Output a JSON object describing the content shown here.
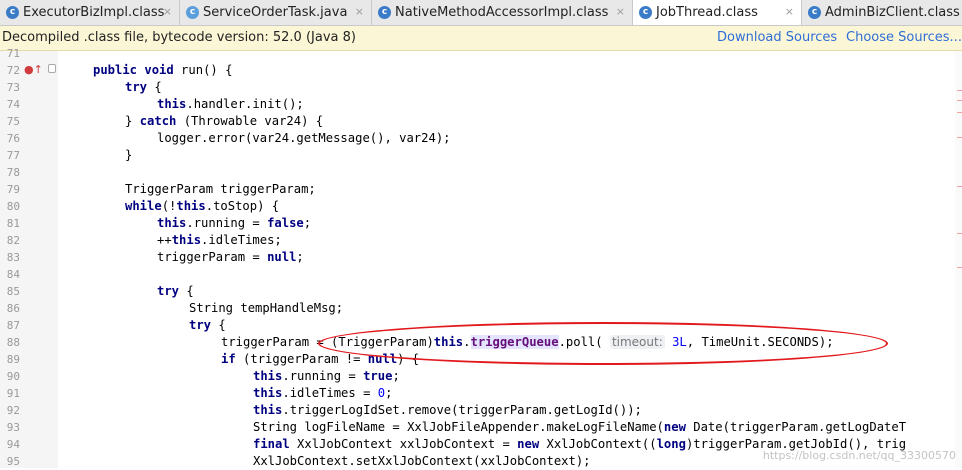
{
  "tabs": [
    {
      "label": "ExecutorBizImpl.class",
      "icon": "class-file-icon",
      "active": false
    },
    {
      "label": "ServiceOrderTask.java",
      "icon": "java-file-icon",
      "active": false
    },
    {
      "label": "NativeMethodAccessorImpl.class",
      "icon": "class-file-icon",
      "active": false
    },
    {
      "label": "JobThread.class",
      "icon": "class-file-icon",
      "active": true
    },
    {
      "label": "AdminBizClient.class",
      "icon": "class-file-icon",
      "active": false
    }
  ],
  "close_glyph": "×",
  "banner": {
    "message": "Decompiled .class file, bytecode version: 52.0 (Java 8)",
    "download_sources": "Download Sources",
    "choose_sources": "Choose Sources..."
  },
  "line_numbers": [
    "71",
    "72",
    "73",
    "74",
    "75",
    "76",
    "77",
    "78",
    "79",
    "80",
    "81",
    "82",
    "83",
    "84",
    "85",
    "86",
    "87",
    "88",
    "89",
    "90",
    "91",
    "92",
    "93",
    "94",
    "95"
  ],
  "code": {
    "l72": {
      "kw1": "public void",
      "t1": " run() {"
    },
    "l73": {
      "kw": "try",
      "t": " {"
    },
    "l74": {
      "fld": "this",
      "t": ".handler.init();"
    },
    "l75": {
      "t1": "} ",
      "kw1": "catch",
      "t2": " (Throwable var24) {"
    },
    "l76": {
      "t": "logger.error(var24.getMessage(), var24);"
    },
    "l77": {
      "t": "}"
    },
    "l79": {
      "t": "TriggerParam triggerParam;"
    },
    "l80": {
      "kw1": "while",
      "t1": "(!",
      "kw2": "this",
      "t2": ".toStop) {"
    },
    "l81": {
      "kw1": "this",
      "t1": ".running = ",
      "kw2": "false",
      "t2": ";"
    },
    "l82": {
      "t1": "++",
      "kw1": "this",
      "t2": ".idleTimes;"
    },
    "l83": {
      "t1": "triggerParam = ",
      "kw1": "null",
      "t2": ";"
    },
    "l85": {
      "kw": "try",
      "t": " {"
    },
    "l86": {
      "t": "String tempHandleMsg;"
    },
    "l87": {
      "kw": "try",
      "t": " {"
    },
    "l88": {
      "t1": "triggerParam = (TriggerParam)",
      "kw1": "this",
      "t2": ".",
      "hl": "triggerQueue",
      "t3": ".poll( ",
      "hint": "timeout:",
      "num": "3L",
      "t4": ", TimeUnit.SECONDS);"
    },
    "l89": {
      "kw1": "if",
      "t1": " (triggerParam != ",
      "kw2": "null",
      "t2": ") {"
    },
    "l90": {
      "kw1": "this",
      "t1": ".running = ",
      "kw2": "true",
      "t2": ";"
    },
    "l91": {
      "kw1": "this",
      "t1": ".idleTimes = ",
      "num": "0",
      "t2": ";"
    },
    "l92": {
      "kw1": "this",
      "t1": ".triggerLogIdSet.remove(triggerParam.getLogId());"
    },
    "l93": {
      "t1": "String logFileName = XxlJobFileAppender.makeLogFileName(",
      "kw1": "new",
      "t2": " Date(triggerParam.getLogDateT"
    },
    "l94": {
      "kw1": "final",
      "t1": " XxlJobContext xxlJobContext = ",
      "kw2": "new",
      "t2": " XxlJobContext((",
      "kw3": "long",
      "t3": ")triggerParam.getJobId(), trig"
    },
    "l95": {
      "t": "XxlJobContext.setXxlJobContext(xxlJobContext);"
    }
  },
  "gutter_icons": {
    "override": "override-method-icon",
    "fold": "fold-toggle-icon"
  },
  "watermark": "https://blog.csdn.net/qq_33300570",
  "colors": {
    "keyword": "#000080",
    "field": "#660e7a",
    "number": "#0000ff",
    "link": "#2f6ed6",
    "banner_bg": "#fbf6d6",
    "annotation_oval": "#e2191c"
  }
}
